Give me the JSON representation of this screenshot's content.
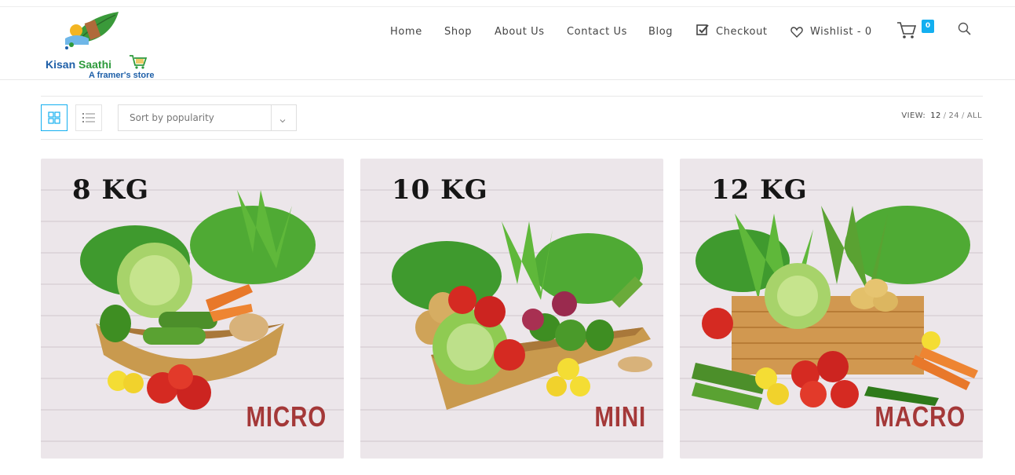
{
  "brand": {
    "name_part1": "Kisan",
    "name_part2": "Saathi",
    "tagline": "A framer's store"
  },
  "nav": {
    "home": "Home",
    "shop": "Shop",
    "about": "About Us",
    "contact": "Contact Us",
    "blog": "Blog",
    "checkout": "Checkout",
    "wishlist": "Wishlist - 0",
    "cart_count": "0",
    "icons": {
      "checkout": "checkbox-check-icon",
      "wishlist": "heart-icon",
      "cart": "cart-icon",
      "search": "search-icon"
    }
  },
  "toolbar": {
    "grid_view_icon": "grid-view-icon",
    "list_view_icon": "list-view-icon",
    "sort_selected": "Sort by popularity",
    "view_label": "VIEW:",
    "view_options": [
      "12",
      "24",
      "ALL"
    ],
    "view_separator": "/"
  },
  "products": [
    {
      "weight": "8 KG",
      "name": "MICRO"
    },
    {
      "weight": "10 KG",
      "name": "MINI"
    },
    {
      "weight": "12 KG",
      "name": "MACRO"
    }
  ],
  "colors": {
    "accent": "#13aff0",
    "label_red": "#a43838",
    "brand_blue": "#1e5fa8",
    "brand_green": "#2e9a3c"
  }
}
